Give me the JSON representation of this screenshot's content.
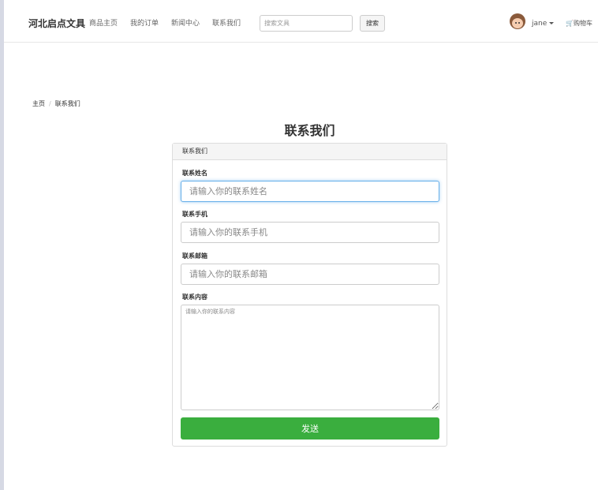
{
  "navbar": {
    "brand": "河北启点文具",
    "links": [
      "商品主页",
      "我的订单",
      "新闻中心",
      "联系我们"
    ],
    "search": {
      "placeholder": "搜索文具",
      "button_label": "搜索"
    },
    "user": {
      "name": "jane"
    },
    "cart_label": "购物车"
  },
  "breadcrumb": {
    "home": "主页",
    "separator": "/",
    "current": "联系我们"
  },
  "page": {
    "title": "联系我们"
  },
  "form": {
    "panel_title": "联系我们",
    "fields": [
      {
        "label": "联系姓名",
        "placeholder": "请输入你的联系姓名"
      },
      {
        "label": "联系手机",
        "placeholder": "请输入你的联系手机"
      },
      {
        "label": "联系邮箱",
        "placeholder": "请输入你的联系邮箱"
      },
      {
        "label": "联系内容",
        "placeholder": "请输入你的联系内容"
      }
    ],
    "submit_label": "发送",
    "submit_color": "#3aae3e",
    "focus_color": "#66afe9"
  }
}
